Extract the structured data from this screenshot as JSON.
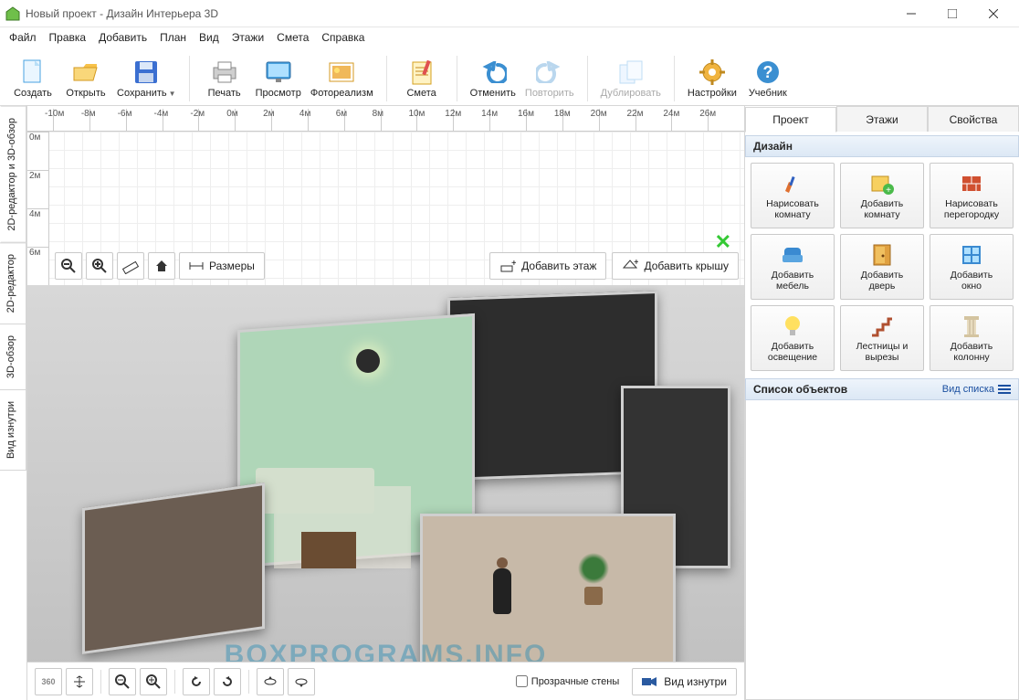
{
  "window": {
    "title": "Новый проект - Дизайн Интерьера 3D"
  },
  "menu": [
    "Файл",
    "Правка",
    "Добавить",
    "План",
    "Вид",
    "Этажи",
    "Смета",
    "Справка"
  ],
  "toolbar": {
    "create": "Создать",
    "open": "Открыть",
    "save": "Сохранить",
    "print": "Печать",
    "preview": "Просмотр",
    "photoreal": "Фотореализм",
    "estimate": "Смета",
    "undo": "Отменить",
    "redo": "Повторить",
    "duplicate": "Дублировать",
    "settings": "Настройки",
    "manual": "Учебник"
  },
  "ruler_h": [
    "-10м",
    "-8м",
    "-6м",
    "-4м",
    "-2м",
    "0м",
    "2м",
    "4м",
    "6м",
    "8м",
    "10м",
    "12м",
    "14м",
    "16м",
    "18м",
    "20м",
    "22м",
    "24м",
    "26м"
  ],
  "ruler_v": [
    "0м",
    "2м",
    "4м",
    "6м"
  ],
  "left_tabs": [
    "2D-редактор и 3D-обзор",
    "2D-редактор",
    "3D-обзор",
    "Вид изнутри"
  ],
  "mid_toolbar": {
    "sizes": "Размеры",
    "add_floor": "Добавить этаж",
    "add_roof": "Добавить крышу"
  },
  "bottom": {
    "transparent_walls": "Прозрачные стены",
    "inside_view": "Вид изнутри"
  },
  "watermark": "BOXPROGRAMS.INFO",
  "right": {
    "tabs": [
      "Проект",
      "Этажи",
      "Свойства"
    ],
    "design_hdr": "Дизайн",
    "objlist_hdr": "Список объектов",
    "view_list": "Вид списка",
    "cards": [
      {
        "l1": "Нарисовать",
        "l2": "комнату"
      },
      {
        "l1": "Добавить",
        "l2": "комнату"
      },
      {
        "l1": "Нарисовать",
        "l2": "перегородку"
      },
      {
        "l1": "Добавить",
        "l2": "мебель"
      },
      {
        "l1": "Добавить",
        "l2": "дверь"
      },
      {
        "l1": "Добавить",
        "l2": "окно"
      },
      {
        "l1": "Добавить",
        "l2": "освещение"
      },
      {
        "l1": "Лестницы и",
        "l2": "вырезы"
      },
      {
        "l1": "Добавить",
        "l2": "колонну"
      }
    ]
  }
}
